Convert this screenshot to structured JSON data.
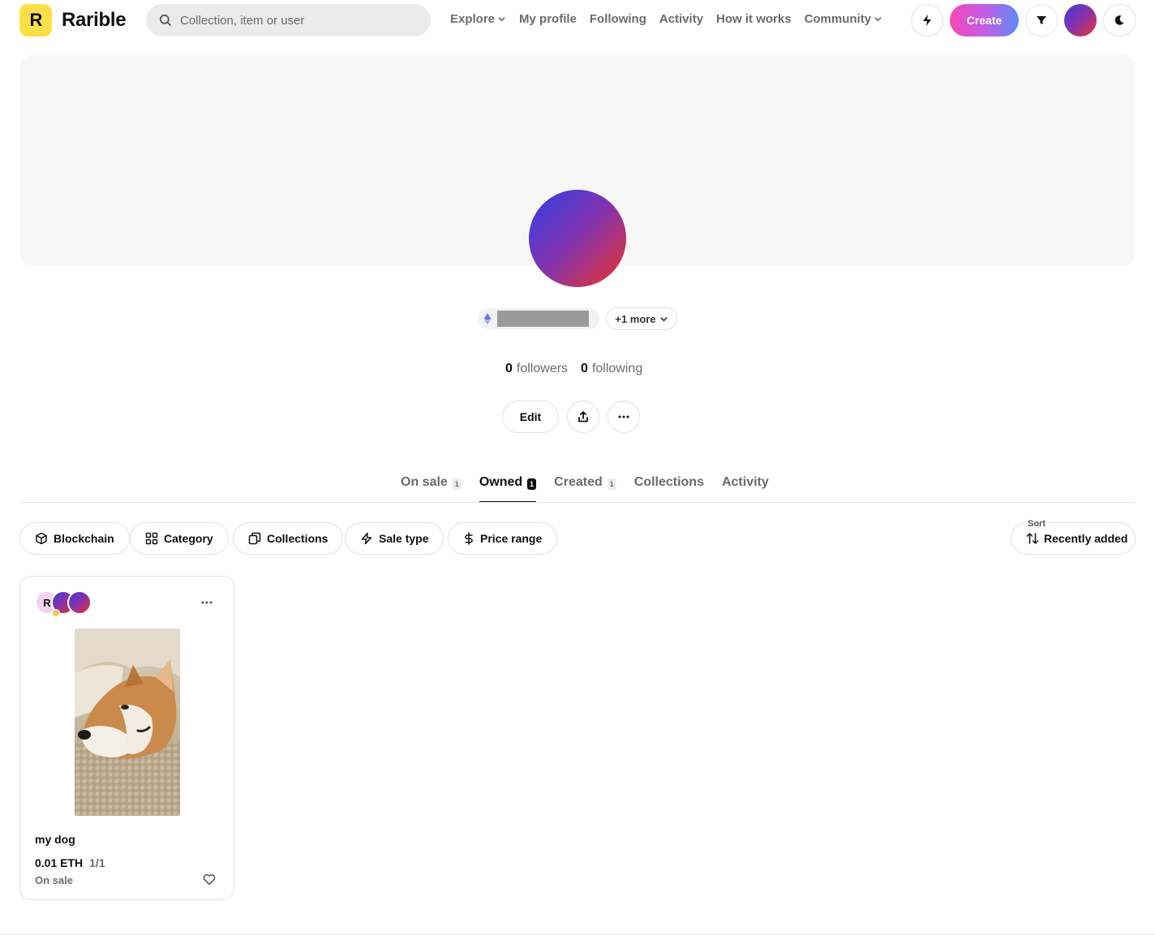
{
  "brand": {
    "name": "Rarible",
    "logo_letter": "R"
  },
  "search": {
    "placeholder": "Collection, item or user"
  },
  "nav": {
    "explore": "Explore",
    "my_profile": "My profile",
    "following": "Following",
    "activity": "Activity",
    "how_it_works": "How it works",
    "community": "Community"
  },
  "header_actions": {
    "create_label": "Create"
  },
  "profile": {
    "more_wallets": "+1 more",
    "followers_count": "0",
    "followers_label": "followers",
    "following_count": "0",
    "following_label": "following",
    "edit_label": "Edit"
  },
  "tabs": [
    {
      "label": "On sale",
      "count": "1"
    },
    {
      "label": "Owned",
      "count": "1"
    },
    {
      "label": "Created",
      "count": "1"
    },
    {
      "label": "Collections"
    },
    {
      "label": "Activity"
    }
  ],
  "filters": {
    "blockchain": "Blockchain",
    "category": "Category",
    "collections": "Collections",
    "sale_type": "Sale type",
    "price_range": "Price range"
  },
  "sort": {
    "label": "Sort",
    "value": "Recently added"
  },
  "items": [
    {
      "title": "my dog",
      "price": "0.01 ETH",
      "edition": "1/1",
      "status": "On sale"
    }
  ],
  "colors": {
    "logo_yellow": "#fde047",
    "create_gradient_start": "#f548b5",
    "create_gradient_end": "#5b8df6"
  }
}
